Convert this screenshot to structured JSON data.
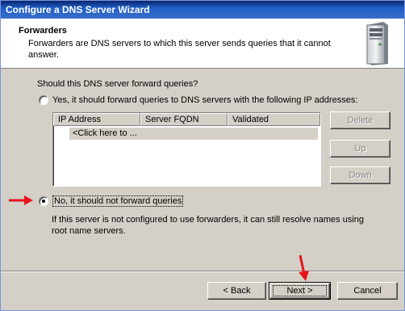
{
  "window": {
    "title": "Configure a DNS Server Wizard"
  },
  "header": {
    "title": "Forwarders",
    "description": "Forwarders are DNS servers to which this server sends queries that it cannot answer.",
    "icon": "server-tower-icon"
  },
  "question": "Should this DNS server forward queries?",
  "option_yes": {
    "label": "Yes, it should forward queries to DNS servers with the following IP addresses:",
    "selected": false
  },
  "forwarders_list": {
    "columns": [
      "IP Address",
      "Server FQDN",
      "Validated"
    ],
    "rows": [
      "<Click here to ..."
    ]
  },
  "list_buttons": {
    "delete": "Delete",
    "up": "Up",
    "down": "Down"
  },
  "option_no": {
    "label": "No, it should not forward queries",
    "selected": true
  },
  "note": "If this server is not configured to use forwarders, it can still resolve names using root name servers.",
  "footer": {
    "back": "< Back",
    "next": "Next >",
    "cancel": "Cancel"
  },
  "annotations": {
    "arrow_color": "#e8141c"
  }
}
